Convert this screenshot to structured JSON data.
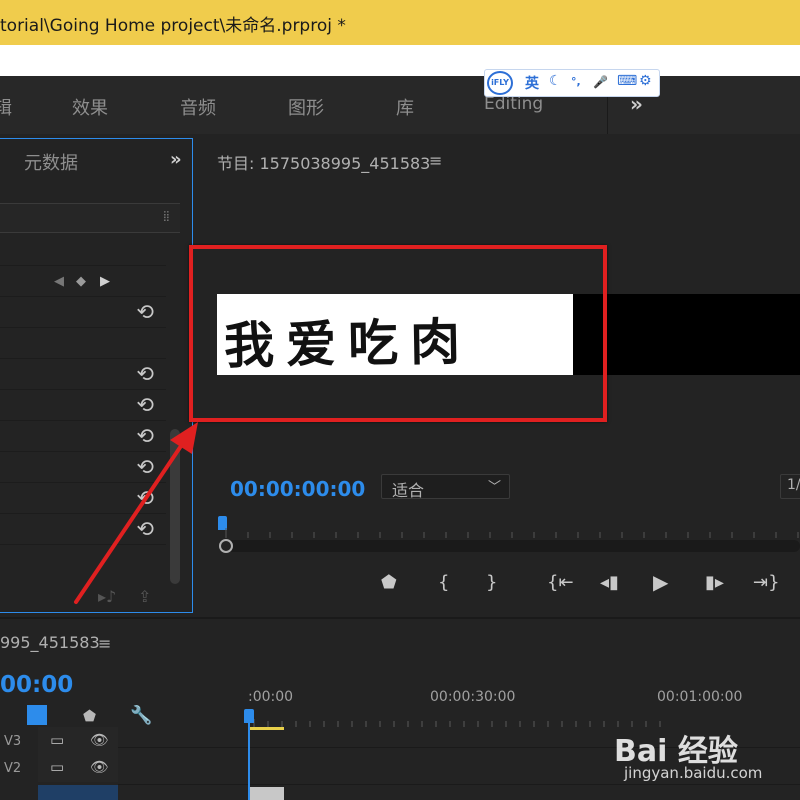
{
  "titlebar": {
    "path": "torial\\Going Home project\\未命名.prproj *"
  },
  "workspaces": {
    "tabs": [
      "效果",
      "音频",
      "图形",
      "库",
      "Editing"
    ],
    "partial_tab": "辑",
    "more": "»"
  },
  "ime": {
    "logo": "iFLY",
    "lang": "英",
    "moon": "☾",
    "punct": "°,",
    "mic": "🎤",
    "kbd": "⌨",
    "gear": "⚙"
  },
  "left_panel": {
    "title": "元数据",
    "more": "»",
    "grip": "⣿"
  },
  "program_monitor": {
    "title": "节目: 1575038995_451583",
    "menu": "≡",
    "caption": "我爱吃肉",
    "timecode": "00:00:00:00",
    "fit": "适合",
    "fraction": "1/"
  },
  "timeline": {
    "sequence_name": "995_451583",
    "menu": "≡",
    "timecode": "00:00",
    "ticks": [
      ":00:00",
      "00:00:30:00",
      "00:01:00:00"
    ],
    "tracks": [
      {
        "label": "V3"
      },
      {
        "label": "V2"
      }
    ]
  },
  "watermark": {
    "brand": "Bai 经验",
    "url": "jingyan.baidu.com"
  },
  "colors": {
    "accent": "#2d8ceb",
    "annotation": "#e02020",
    "titlebar": "#f0cc4c"
  }
}
